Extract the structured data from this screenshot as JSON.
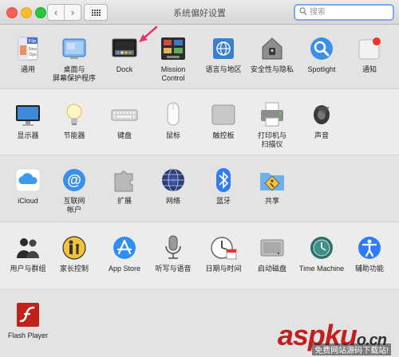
{
  "window": {
    "title": "系统偏好设置"
  },
  "toolbar": {
    "back": "‹",
    "forward": "›"
  },
  "search": {
    "placeholder": "搜索"
  },
  "rows": [
    [
      {
        "id": "general",
        "label": "通用",
        "icon": "general-icon"
      },
      {
        "id": "desktop",
        "label": "桌面与\n屏幕保护程序",
        "icon": "desktop-screensaver-icon"
      },
      {
        "id": "dock",
        "label": "Dock",
        "icon": "dock-icon"
      },
      {
        "id": "mission",
        "label": "Mission\nControl",
        "icon": "mission-control-icon"
      },
      {
        "id": "language",
        "label": "语言与地区",
        "icon": "language-region-icon"
      },
      {
        "id": "security",
        "label": "安全性与隐私",
        "icon": "security-privacy-icon"
      },
      {
        "id": "spotlight",
        "label": "Spotlight",
        "icon": "spotlight-icon"
      },
      {
        "id": "notifications",
        "label": "通知",
        "icon": "notifications-icon"
      }
    ],
    [
      {
        "id": "displays",
        "label": "显示器",
        "icon": "displays-icon"
      },
      {
        "id": "energy",
        "label": "节能器",
        "icon": "energy-saver-icon"
      },
      {
        "id": "keyboard",
        "label": "键盘",
        "icon": "keyboard-icon"
      },
      {
        "id": "mouse",
        "label": "鼠标",
        "icon": "mouse-icon"
      },
      {
        "id": "trackpad",
        "label": "触控板",
        "icon": "trackpad-icon"
      },
      {
        "id": "printers",
        "label": "打印机与\n扫描仪",
        "icon": "printer-icon"
      },
      {
        "id": "sound",
        "label": "声音",
        "icon": "sound-icon"
      }
    ],
    [
      {
        "id": "icloud",
        "label": "iCloud",
        "icon": "icloud-icon"
      },
      {
        "id": "internet",
        "label": "互联网\n帐户",
        "icon": "internet-accounts-icon"
      },
      {
        "id": "extensions",
        "label": "扩展",
        "icon": "extensions-icon"
      },
      {
        "id": "network",
        "label": "网络",
        "icon": "network-icon"
      },
      {
        "id": "bluetooth",
        "label": "蓝牙",
        "icon": "bluetooth-icon"
      },
      {
        "id": "sharing",
        "label": "共享",
        "icon": "sharing-icon"
      }
    ],
    [
      {
        "id": "users",
        "label": "用户与群组",
        "icon": "users-groups-icon"
      },
      {
        "id": "parental",
        "label": "家长控制",
        "icon": "parental-controls-icon"
      },
      {
        "id": "appstore",
        "label": "App Store",
        "icon": "app-store-icon"
      },
      {
        "id": "dictation",
        "label": "听写与语音",
        "icon": "dictation-speech-icon"
      },
      {
        "id": "datetime",
        "label": "日期与时间",
        "icon": "date-time-icon"
      },
      {
        "id": "startup",
        "label": "启动磁盘",
        "icon": "startup-disk-icon"
      },
      {
        "id": "timemachine",
        "label": "Time Machine",
        "icon": "time-machine-icon"
      },
      {
        "id": "accessibility",
        "label": "辅助功能",
        "icon": "accessibility-icon"
      }
    ],
    [
      {
        "id": "flash",
        "label": "Flash Player",
        "icon": "flash-player-icon"
      }
    ]
  ],
  "annotation": {
    "target": "dock",
    "color": "#e8336b",
    "icon": "arrow-icon"
  },
  "watermark": {
    "logo": "aspku",
    "logo_suffix": "o.cn",
    "subtitle": "免费网站源码下载站!"
  },
  "colors": {
    "search_focus": "#7aa9f0",
    "accent": "#2f7cf6"
  }
}
